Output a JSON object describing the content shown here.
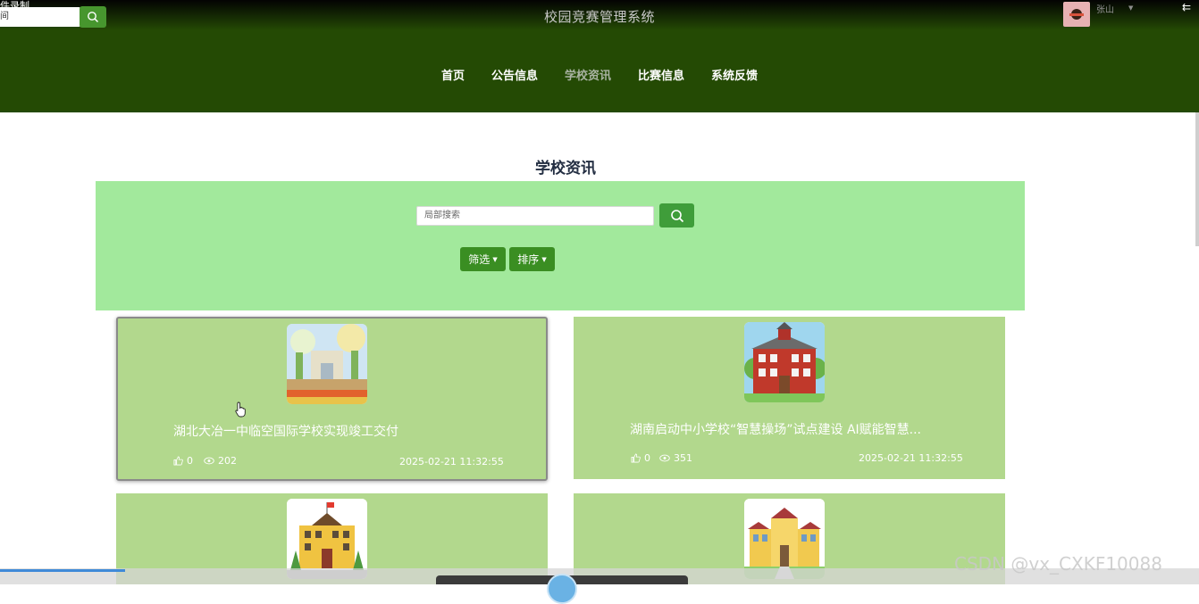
{
  "recorder": {
    "label": "件录制",
    "sub": "间"
  },
  "header": {
    "app_title": "校园竞赛管理系统",
    "user_name": "张山",
    "nav": [
      {
        "label": "首页",
        "active": false
      },
      {
        "label": "公告信息",
        "active": false
      },
      {
        "label": "学校资讯",
        "active": true
      },
      {
        "label": "比赛信息",
        "active": false
      },
      {
        "label": "系统反馈",
        "active": false
      }
    ]
  },
  "main": {
    "page_title": "学校资讯",
    "search": {
      "placeholder": "局部搜索",
      "value": ""
    },
    "filter_label": "筛选",
    "sort_label": "排序",
    "articles": [
      {
        "title": "湖北大冶一中临空国际学校实现竣工交付",
        "likes": "0",
        "views": "202",
        "date": "2025-02-21 11:32:55"
      },
      {
        "title": "湖南启动中小学校“智慧操场”试点建设 AI赋能智慧...",
        "likes": "0",
        "views": "351",
        "date": "2025-02-21 11:32:55"
      },
      {
        "title": "",
        "likes": "",
        "views": "",
        "date": ""
      },
      {
        "title": "",
        "likes": "",
        "views": "",
        "date": ""
      }
    ]
  },
  "watermark": "CSDN @vx_CXKF10088",
  "colors": {
    "header_bg": "#244a04",
    "panel_bg": "#a2e99c",
    "card_bg": "#b2d88d",
    "button_green": "#3a8e22"
  }
}
